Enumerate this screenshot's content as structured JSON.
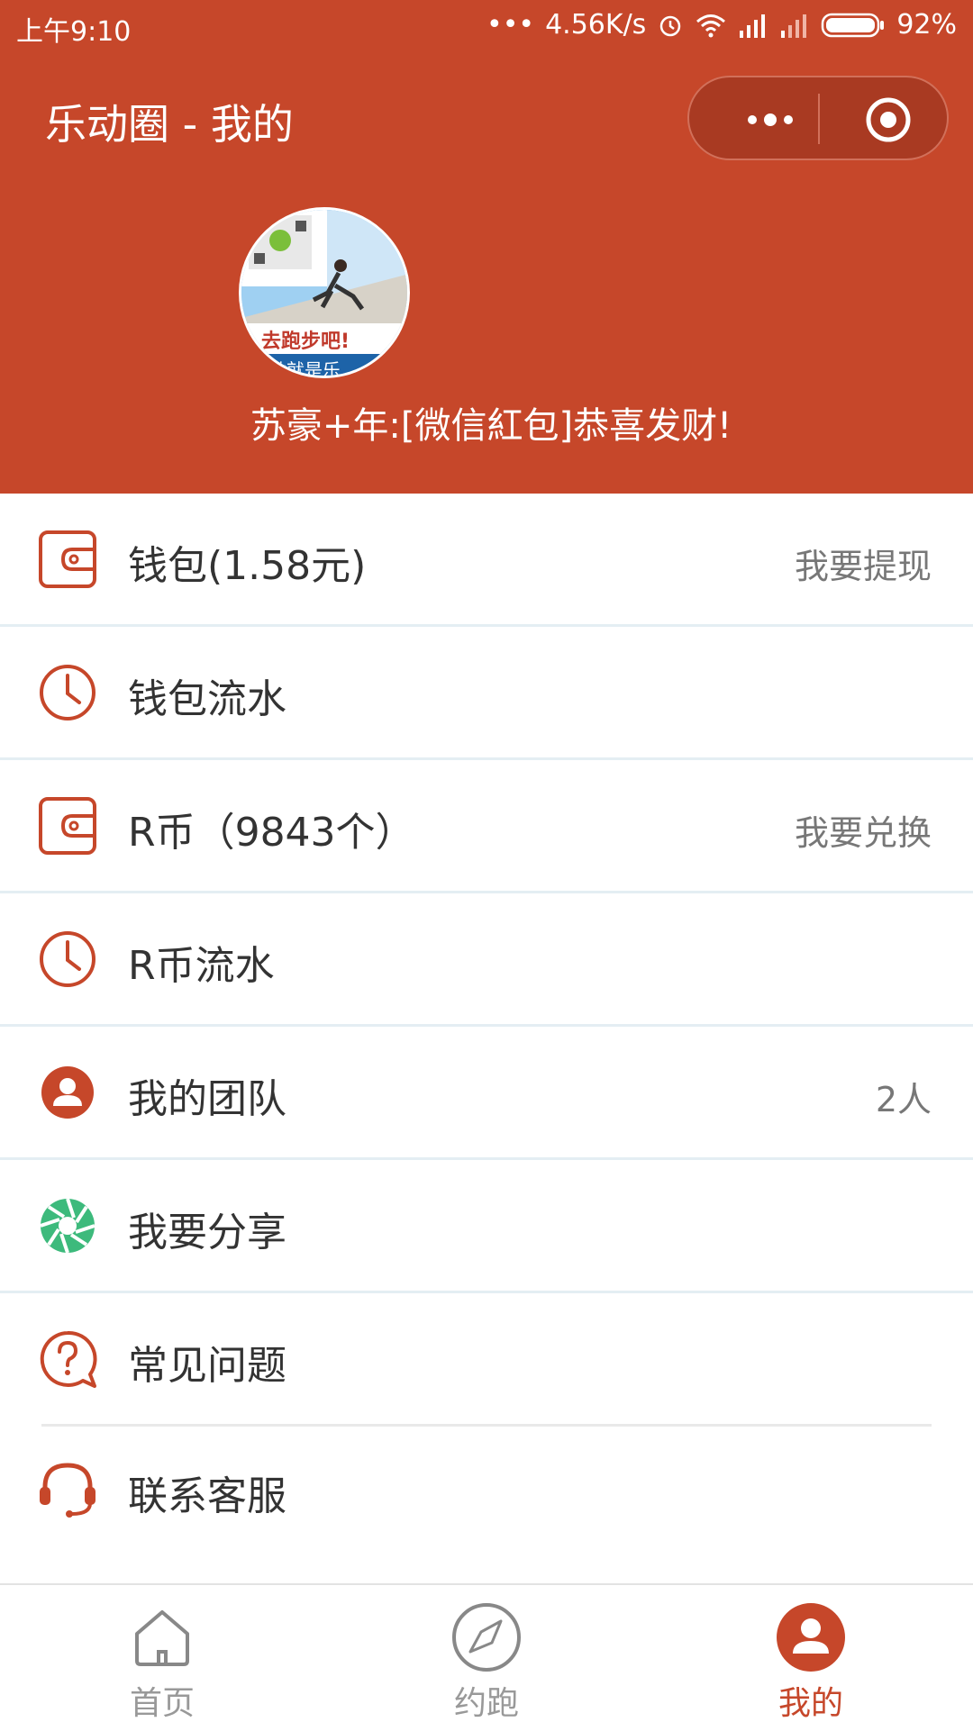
{
  "status_bar": {
    "time": "上午9:10",
    "speed": "4.56K/s",
    "battery": "92%"
  },
  "nav": {
    "title": "乐动圈 - 我的"
  },
  "profile": {
    "username": "苏豪+年:[微信紅包]恭喜发财!",
    "avatar_text": "去跑步吧!",
    "avatar_banner": "动就是乐"
  },
  "menu": [
    {
      "label": "钱包(1.58元)",
      "extra": "我要提现",
      "icon": "wallet-icon"
    },
    {
      "label": "钱包流水",
      "extra": "",
      "icon": "clock-icon"
    },
    {
      "label": "R币（9843个）",
      "extra": "我要兑换",
      "icon": "wallet-icon"
    },
    {
      "label": "R币流水",
      "extra": "",
      "icon": "clock-icon"
    },
    {
      "label": "我的团队",
      "extra": "2人",
      "icon": "user-icon"
    },
    {
      "label": "我要分享",
      "extra": "",
      "icon": "share-shutter-icon"
    },
    {
      "label": "常见问题",
      "extra": "",
      "icon": "question-bubble-icon"
    },
    {
      "label": "联系客服",
      "extra": "",
      "icon": "headset-icon"
    }
  ],
  "tabbar": [
    {
      "label": "首页",
      "icon": "home-icon",
      "active": false
    },
    {
      "label": "约跑",
      "icon": "compass-icon",
      "active": false
    },
    {
      "label": "我的",
      "icon": "user-icon",
      "active": true
    }
  ],
  "colors": {
    "brand": "#c6472a",
    "share_green": "#3dba7c"
  }
}
